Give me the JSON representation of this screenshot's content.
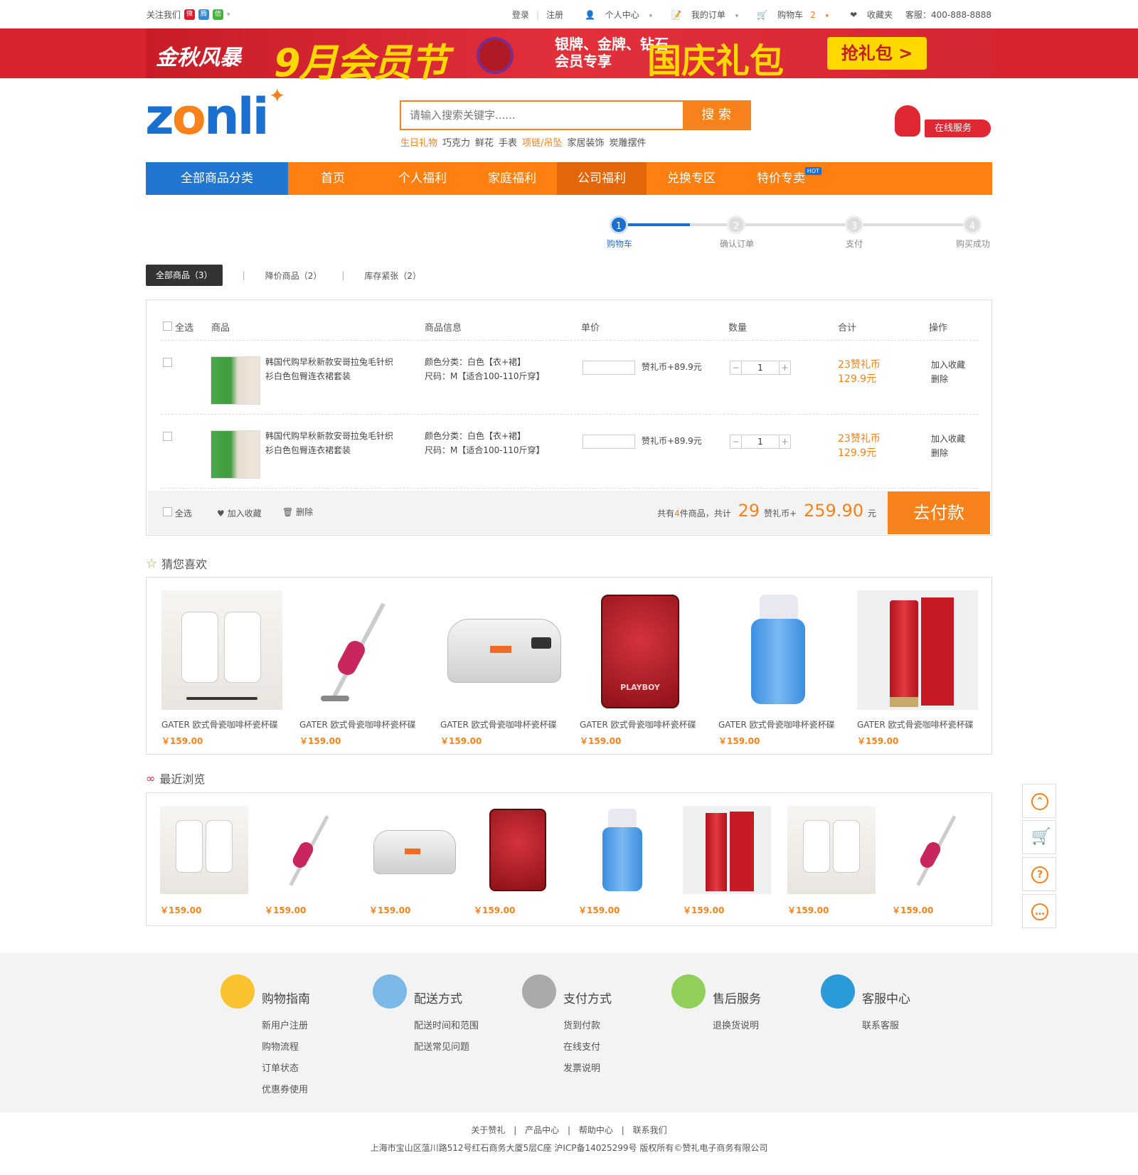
{
  "topbar": {
    "follow": "关注我们",
    "login": "登录",
    "register": "注册",
    "personal": "个人中心",
    "orders": "我的订单",
    "cart": "购物车",
    "cart_count": "2",
    "favorites": "收藏夹",
    "service": "客服：400-888-8888"
  },
  "banner": {
    "t1": "金秋风暴",
    "t2": "9月会员节",
    "t3": "银牌、金牌、钻石",
    "t4": "会员专享",
    "t5": "国庆礼包",
    "btn": "抢礼包 >"
  },
  "logo": {
    "text_a": "z",
    "text_o": "o",
    "text_b": "nli"
  },
  "search": {
    "placeholder": "请输入搜索关键字......",
    "button": "搜 索",
    "hot": [
      "生日礼物",
      "巧克力",
      "鲜花",
      "手表",
      "项链/吊坠",
      "家居装饰",
      "炭雕摆件"
    ]
  },
  "online_service": "在线服务",
  "nav": {
    "all": "全部商品分类",
    "items": [
      "首页",
      "个人福利",
      "家庭福利",
      "公司福利",
      "兑换专区",
      "特价专卖"
    ],
    "hot_badge": "HOT"
  },
  "steps": [
    {
      "num": "1",
      "label": "购物车"
    },
    {
      "num": "2",
      "label": "确认订单"
    },
    {
      "num": "3",
      "label": "支付"
    },
    {
      "num": "4",
      "label": "购买成功"
    }
  ],
  "tabs": [
    "全部商品（3）",
    "降价商品（2）",
    "库存紧张（2）"
  ],
  "cart": {
    "headers": {
      "select_all": "全选",
      "product": "商品",
      "info": "商品信息",
      "price": "单价",
      "qty": "数量",
      "total": "合计",
      "ops": "操作"
    },
    "rows": [
      {
        "name": "韩国代购早秋新款安哥拉兔毛针织衫白色包臀连衣裙套装",
        "color": "颜色分类：白色【衣+裙】",
        "size": "尺码：M【适合100-110斤穿】",
        "price": "赞礼币+89.9元",
        "qty": "1",
        "total1": "23赞礼币",
        "total2": "129.9元",
        "op1": "加入收藏",
        "op2": "删除"
      },
      {
        "name": "韩国代购早秋新款安哥拉兔毛针织衫白色包臀连衣裙套装",
        "color": "颜色分类：白色【衣+裙】",
        "size": "尺码：M【适合100-110斤穿】",
        "price": "赞礼币+89.9元",
        "qty": "1",
        "total1": "23赞礼币",
        "total2": "129.9元",
        "op1": "加入收藏",
        "op2": "删除"
      }
    ],
    "footer": {
      "select_all": "全选",
      "fav": "加入收藏",
      "del": "删除",
      "count_pre": "共有",
      "count": "4",
      "count_post": "件商品，共计",
      "coins": "29",
      "coins_unit": "赞礼币+",
      "amount": "259.90",
      "amount_unit": "元",
      "pay": "去付款"
    }
  },
  "guess": {
    "title": "猜您喜欢",
    "items": [
      {
        "name": "GATER 欧式骨瓷咖啡杯瓷杯碟",
        "price": "￥159.00"
      },
      {
        "name": "GATER 欧式骨瓷咖啡杯瓷杯碟",
        "price": "￥159.00"
      },
      {
        "name": "GATER 欧式骨瓷咖啡杯瓷杯碟",
        "price": "￥159.00"
      },
      {
        "name": "GATER 欧式骨瓷咖啡杯瓷杯碟",
        "price": "￥159.00"
      },
      {
        "name": "GATER 欧式骨瓷咖啡杯瓷杯碟",
        "price": "￥159.00"
      },
      {
        "name": "GATER 欧式骨瓷咖啡杯瓷杯碟",
        "price": "￥159.00"
      }
    ]
  },
  "recent": {
    "title": "最近浏览",
    "prices": [
      "￥159.00",
      "￥159.00",
      "￥159.00",
      "￥159.00",
      "￥159.00",
      "￥159.00",
      "￥159.00",
      "￥159.00"
    ]
  },
  "footer": {
    "cols": [
      {
        "title": "购物指南",
        "links": [
          "新用户注册",
          "购物流程",
          "订单状态",
          "优惠券使用"
        ]
      },
      {
        "title": "配送方式",
        "links": [
          "配送时间和范围",
          "配送常见问题"
        ]
      },
      {
        "title": "支付方式",
        "links": [
          "货到付款",
          "在线支付",
          "发票说明"
        ]
      },
      {
        "title": "售后服务",
        "links": [
          "退换货说明"
        ]
      },
      {
        "title": "客服中心",
        "links": [
          "联系客服"
        ]
      }
    ],
    "links": [
      "关于赞礼",
      "产品中心",
      "帮助中心",
      "联系我们"
    ],
    "copyright": "上海市宝山区蕰川路512号红石商务大厦5层C座 沪ICP备14025299号 版权所有©赞礼电子商务有限公司"
  }
}
